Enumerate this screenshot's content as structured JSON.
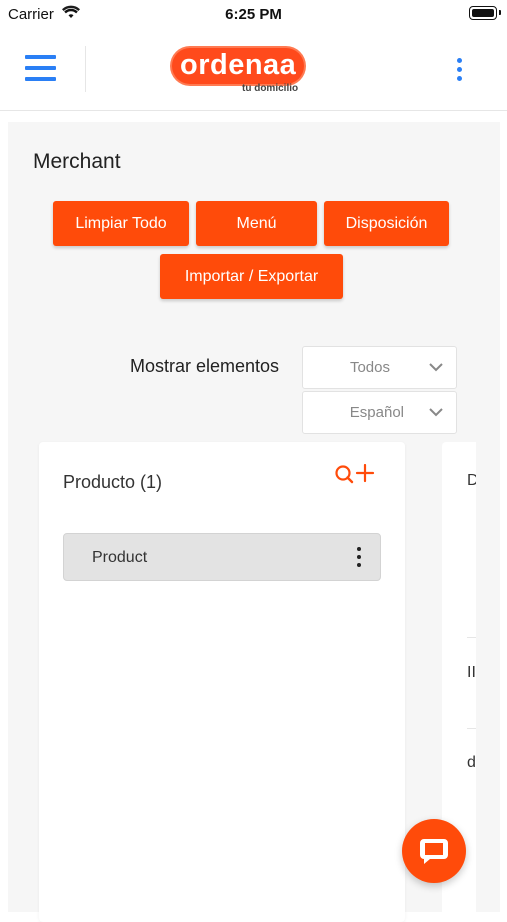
{
  "status": {
    "carrier": "Carrier",
    "time": "6:25 PM"
  },
  "header": {
    "logo_text": "ordenaa",
    "logo_tagline": "tu domicilio",
    "menu_icon": "hamburger-icon",
    "more_icon": "kebab-icon"
  },
  "page": {
    "title": "Merchant",
    "buttons": {
      "clear_all": "Limpiar Todo",
      "menu": "Menú",
      "layout": "Disposición",
      "import_export": "Importar / Exportar"
    },
    "show_items_label": "Mostrar elementos",
    "show_items_value": "Todos",
    "language_value": "Español"
  },
  "product_card": {
    "title": "Producto (1)",
    "items": [
      {
        "label": "Product"
      }
    ]
  },
  "peek_card": {
    "letters": [
      "D",
      "II",
      "d"
    ]
  },
  "colors": {
    "accent": "#ff4b0a",
    "link": "#2a7ff5"
  }
}
